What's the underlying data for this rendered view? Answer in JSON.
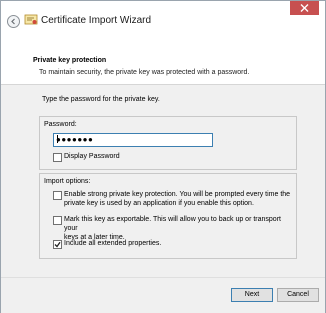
{
  "window": {
    "title": "Certificate Import Wizard"
  },
  "header": {
    "title": "Private key protection",
    "description": "To maintain security, the private key was protected with a password."
  },
  "content": {
    "prompt": "Type the password for the private key.",
    "password_group": {
      "label": "Password:",
      "value": "●●●●●●●",
      "show_password": {
        "label": "Display Password",
        "checked": false
      }
    },
    "import_options": {
      "label": "Import options:",
      "options": [
        {
          "label": "Enable strong private key protection. You will be prompted every time the",
          "label2": "private key is used by an application if you enable this option.",
          "checked": false
        },
        {
          "label": "Mark this key as exportable. This will allow you to back up or transport your",
          "label2": "keys at a later time.",
          "checked": false
        },
        {
          "label": "Include all extended properties.",
          "checked": true
        }
      ]
    }
  },
  "footer": {
    "next_label": "Next",
    "cancel_label": "Cancel"
  },
  "icons": {
    "back": "back-arrow-icon",
    "close": "close-icon",
    "wizard": "certificate-icon",
    "check": "checkmark-icon"
  },
  "colors": {
    "close_bg": "#c75050",
    "focus_border": "#3c7fb1"
  }
}
